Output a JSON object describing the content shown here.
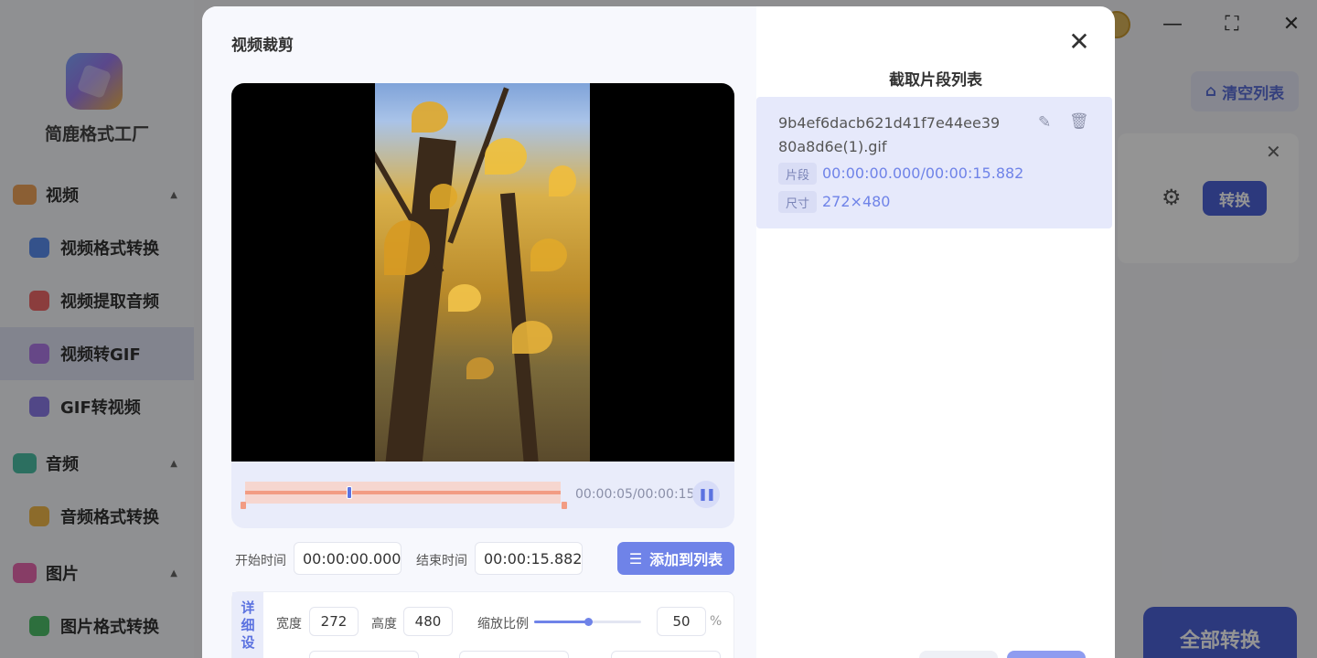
{
  "app": {
    "name": "简鹿格式工厂",
    "nav": [
      {
        "group": "视频",
        "items": [
          "视频格式转换",
          "视频提取音频",
          "视频转GIF",
          "GIF转视频"
        ]
      },
      {
        "group": "音频",
        "items": [
          "音频格式转换"
        ]
      },
      {
        "group": "图片",
        "items": [
          "图片格式转换"
        ]
      }
    ],
    "active_item": "视频转GIF",
    "clear_list_label": "清空列表",
    "convert_label": "转换",
    "convert_all_label": "全部转换"
  },
  "dialog": {
    "title": "视频裁剪",
    "player": {
      "time_readout": "00:00:05/00:00:15",
      "progress_fraction": 0.333
    },
    "start_time_label": "开始时间",
    "start_time_value": "00:00:00.000",
    "end_time_label": "结束时间",
    "end_time_value": "00:00:15.882",
    "add_to_list_label": "添加到列表",
    "details": {
      "tab_label": "详细设",
      "width_label": "宽度",
      "width_value": "272",
      "height_label": "高度",
      "height_value": "480",
      "scale_label": "缩放比例",
      "scale_value": "50",
      "scale_unit": "%"
    },
    "segment_list": {
      "title": "截取片段列表",
      "items": [
        {
          "filename": "9b4ef6dacb621d41f7e44ee3980a8d6e(1).gif",
          "segment_tag": "片段",
          "segment_value": "00:00:00.000/00:00:15.882",
          "size_tag": "尺寸",
          "size_value": "272×480"
        }
      ]
    }
  },
  "colors": {
    "accent": "#6f83e8",
    "track": "#f29c83"
  }
}
